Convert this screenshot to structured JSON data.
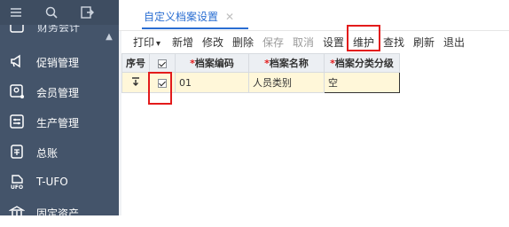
{
  "sidebar": {
    "partial_item_label": "财务会计",
    "items": [
      {
        "label": "促销管理",
        "icon": "megaphone-icon"
      },
      {
        "label": "会员管理",
        "icon": "member-icon"
      },
      {
        "label": "生产管理",
        "icon": "production-icon"
      },
      {
        "label": "总账",
        "icon": "ledger-icon"
      },
      {
        "label": "T-UFO",
        "icon": "ufo-icon"
      },
      {
        "label": "固定资产",
        "icon": "bank-icon"
      }
    ]
  },
  "tab": {
    "label": "自定义档案设置",
    "close": "✕"
  },
  "toolbar": {
    "print": "打印",
    "print_caret": "▾",
    "add": "新增",
    "edit": "修改",
    "delete": "删除",
    "save": "保存",
    "cancel": "取消",
    "settings": "设置",
    "maintain": "维护",
    "find": "查找",
    "refresh": "刷新",
    "exit": "退出"
  },
  "grid": {
    "headers": {
      "seq": "序号",
      "code": "档案编码",
      "name": "档案名称",
      "level": "档案分类分级"
    },
    "rows": [
      {
        "seq": "",
        "checked": true,
        "code": "01",
        "name": "人员类别",
        "level": "空"
      }
    ]
  },
  "colors": {
    "sidebar_bg": "#44546a",
    "accent": "#2a6ed2",
    "highlight": "#e31b1b",
    "row_selected": "#fff7d9"
  }
}
